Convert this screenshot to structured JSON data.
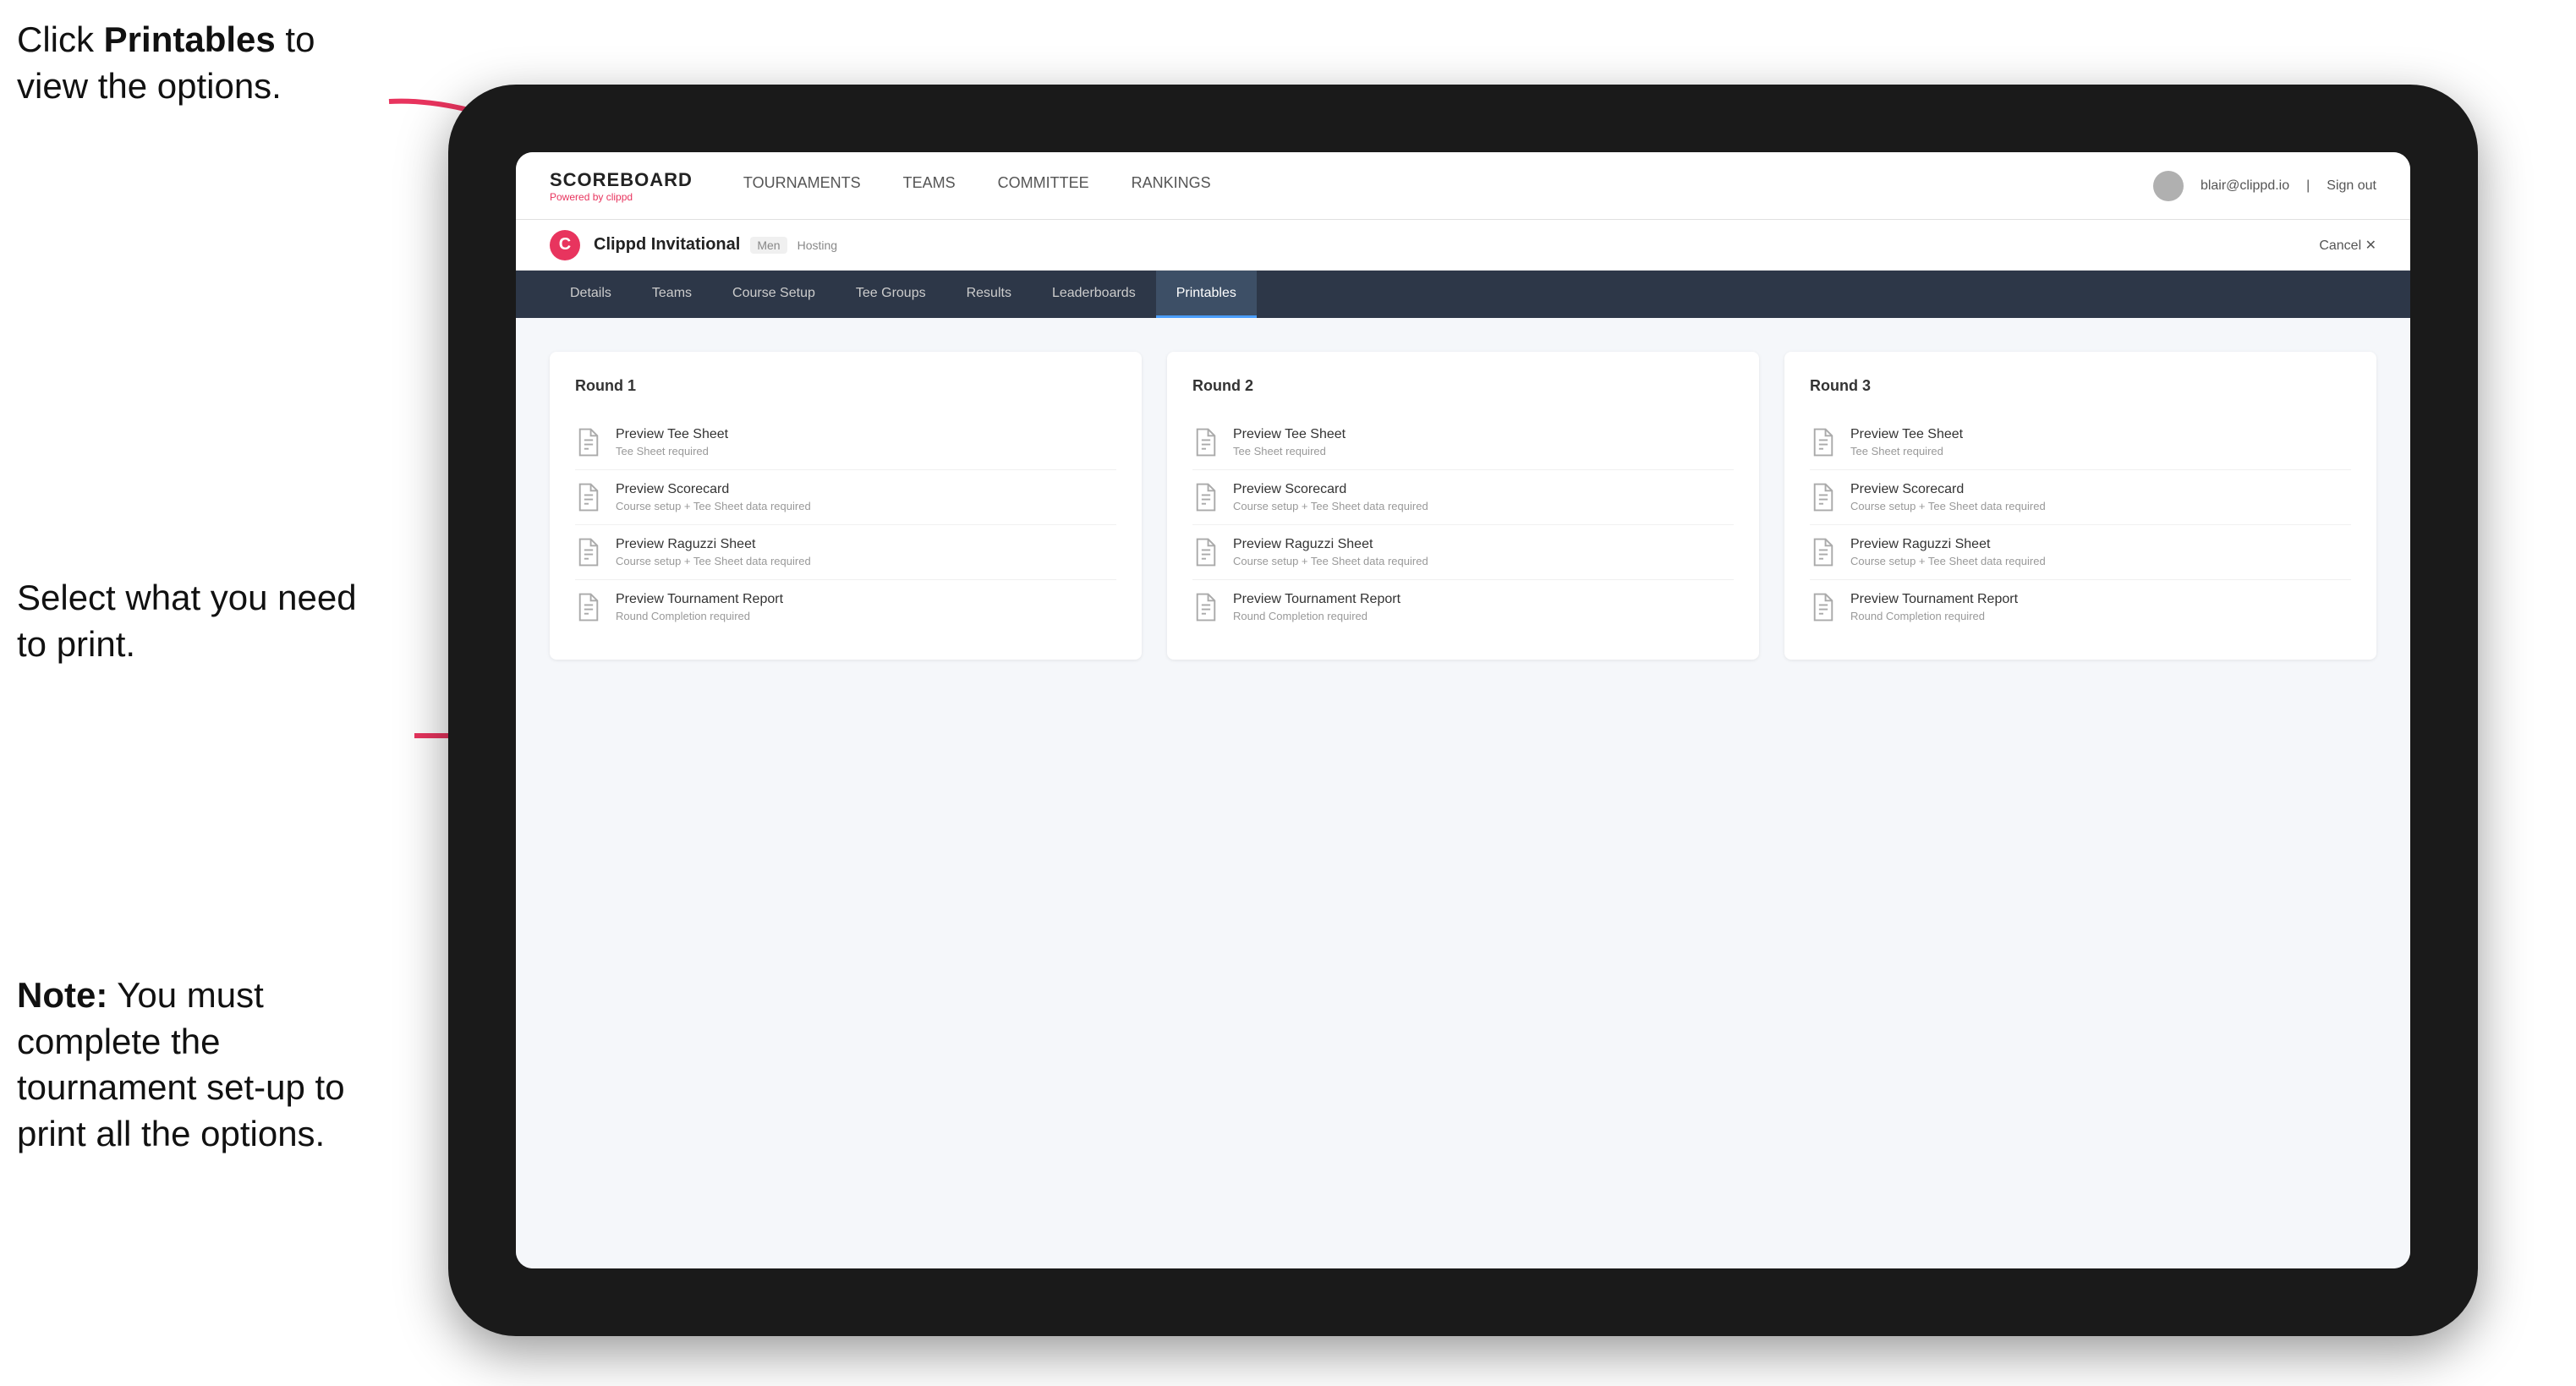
{
  "instructions": {
    "top": {
      "prefix": "Click ",
      "bold": "Printables",
      "suffix": " to view the options."
    },
    "middle": {
      "text": "Select what you need to print."
    },
    "bottom": {
      "bold": "Note:",
      "suffix": " You must complete the tournament set-up to print all the options."
    }
  },
  "nav": {
    "logo_title": "SCOREBOARD",
    "logo_sub": "Powered by clippd",
    "links": [
      {
        "label": "TOURNAMENTS",
        "active": false
      },
      {
        "label": "TEAMS",
        "active": false
      },
      {
        "label": "COMMITTEE",
        "active": false
      },
      {
        "label": "RANKINGS",
        "active": false
      }
    ],
    "user_email": "blair@clippd.io",
    "sign_out": "Sign out"
  },
  "sub_header": {
    "logo_letter": "C",
    "tournament_name": "Clippd Invitational",
    "tournament_badge": "Men",
    "hosting": "Hosting",
    "cancel": "Cancel"
  },
  "tabs": [
    {
      "label": "Details",
      "active": false
    },
    {
      "label": "Teams",
      "active": false
    },
    {
      "label": "Course Setup",
      "active": false
    },
    {
      "label": "Tee Groups",
      "active": false
    },
    {
      "label": "Results",
      "active": false
    },
    {
      "label": "Leaderboards",
      "active": false
    },
    {
      "label": "Printables",
      "active": true
    }
  ],
  "rounds": [
    {
      "title": "Round 1",
      "items": [
        {
          "title": "Preview Tee Sheet",
          "sub": "Tee Sheet required"
        },
        {
          "title": "Preview Scorecard",
          "sub": "Course setup + Tee Sheet data required"
        },
        {
          "title": "Preview Raguzzi Sheet",
          "sub": "Course setup + Tee Sheet data required"
        },
        {
          "title": "Preview Tournament Report",
          "sub": "Round Completion required"
        }
      ]
    },
    {
      "title": "Round 2",
      "items": [
        {
          "title": "Preview Tee Sheet",
          "sub": "Tee Sheet required"
        },
        {
          "title": "Preview Scorecard",
          "sub": "Course setup + Tee Sheet data required"
        },
        {
          "title": "Preview Raguzzi Sheet",
          "sub": "Course setup + Tee Sheet data required"
        },
        {
          "title": "Preview Tournament Report",
          "sub": "Round Completion required"
        }
      ]
    },
    {
      "title": "Round 3",
      "items": [
        {
          "title": "Preview Tee Sheet",
          "sub": "Tee Sheet required"
        },
        {
          "title": "Preview Scorecard",
          "sub": "Course setup + Tee Sheet data required"
        },
        {
          "title": "Preview Raguzzi Sheet",
          "sub": "Course setup + Tee Sheet data required"
        },
        {
          "title": "Preview Tournament Report",
          "sub": "Round Completion required"
        }
      ]
    }
  ]
}
